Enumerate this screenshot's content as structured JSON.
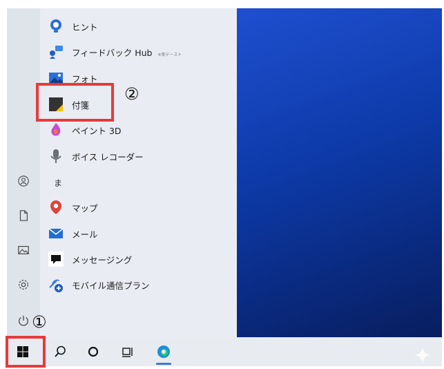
{
  "start_menu": {
    "apps": [
      {
        "label": "ヒント",
        "icon": "lightbulb-icon"
      },
      {
        "label": "フィードバック Hub",
        "icon": "feedback-hub-icon",
        "sublabel": "※実テースト"
      },
      {
        "label": "フォト",
        "icon": "photos-icon"
      },
      {
        "label": "付箋",
        "icon": "sticky-notes-icon"
      },
      {
        "label": "ペイント 3D",
        "icon": "paint-3d-icon"
      },
      {
        "label": "ボイス レコーダー",
        "icon": "voice-recorder-icon"
      },
      {
        "label": "マップ",
        "icon": "maps-icon"
      },
      {
        "label": "メール",
        "icon": "mail-icon"
      },
      {
        "label": "メッセージング",
        "icon": "messaging-icon"
      },
      {
        "label": "モバイル通信プラン",
        "icon": "mobile-plans-icon"
      }
    ],
    "section_letter": "ま"
  },
  "rail": [
    "user-icon",
    "documents-icon",
    "pictures-icon",
    "settings-icon",
    "power-icon"
  ],
  "annotations": {
    "step1": "①",
    "step2": "②"
  },
  "taskbar": [
    "windows-start-icon",
    "search-icon",
    "cortana-icon",
    "task-view-icon",
    "edge-icon"
  ],
  "colors": {
    "highlight": "#e63a3a",
    "desktop": "#0d3aa8",
    "menu_bg": "#e9ecf2"
  }
}
